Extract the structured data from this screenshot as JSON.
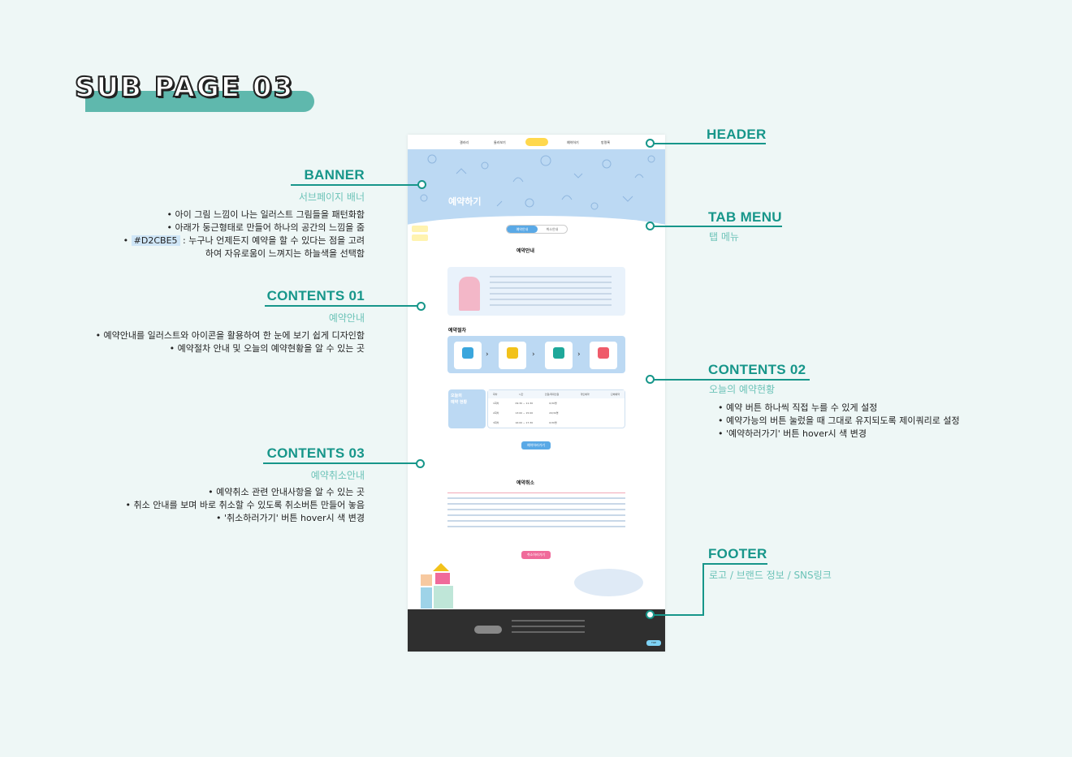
{
  "page_title": "SUB PAGE 03",
  "colors": {
    "accent": "#17968a",
    "banner_blue": "#D2CBE5",
    "footer": "#2f2f2f"
  },
  "annotations": {
    "header": {
      "title": "HEADER"
    },
    "banner": {
      "title": "BANNER",
      "subtitle": "서브페이지 배너",
      "lines": [
        "• 아이 그림 느낌이 나는  일러스트 그림들을 패턴화함",
        "• 아래가 둥근형태로 만들어 하나의 공간의 느낌을 줌",
        "#D2CBE5",
        ": 누구나 언제든지 예약을 할 수 있다는 점을 고려",
        "하여 자유로움이 느껴지는 하늘색을 선택함"
      ]
    },
    "tab_menu": {
      "title": "TAB MENU",
      "subtitle": "탭 메뉴"
    },
    "contents01": {
      "title": "CONTENTS 01",
      "subtitle": "예약안내",
      "lines": [
        "• 예약안내를 일러스트와 아이콘을 활용하여 한 눈에 보기 쉽게 디자인함",
        "• 예약절차 안내 및 오늘의 예약현황을 알 수 있는 곳"
      ]
    },
    "contents02": {
      "title": "CONTENTS 02",
      "subtitle": "오늘의 예약현황",
      "lines": [
        "• 예약 버튼 하나씩 직접 누를 수 있게 설정",
        "• 예약가능의 버튼 눌렀을 때 그대로 유지되도록 제이쿼리로 설정",
        "• '예약하러가기' 버튼 hover시 색 변경"
      ]
    },
    "contents03": {
      "title": "CONTENTS 03",
      "subtitle": "예약취소안내",
      "lines": [
        "• 예약취소 관련 안내사항을 알 수 있는 곳",
        "• 취소 안내를 보며 바로 취소할 수 있도록 취소버튼 만들어 놓음",
        "• '취소하러가기' 버튼 hover시 색 변경"
      ]
    },
    "footer": {
      "title": "FOOTER",
      "subtitle": "로고 / 브랜드 정보 / SNS링크"
    }
  },
  "mockup": {
    "nav": [
      "갤러리",
      "둘러보기",
      "예약하기",
      "방명록"
    ],
    "banner_title": "예약하기",
    "tabs": [
      "예약안내",
      "취소안내"
    ],
    "section_reserve": "예약안내",
    "section_steps": "예약절차",
    "today": [
      "오늘의",
      "예약 현황"
    ],
    "table_header": [
      "회차",
      "시간",
      "인원/최대인원",
      "개인예약",
      "단체예약"
    ],
    "table_rows": [
      [
        "1회차",
        "09:30 ~ 11:30",
        "0/30명"
      ],
      [
        "2회차",
        "13:00 ~ 15:00",
        "20/30명"
      ],
      [
        "3회차",
        "16:00 ~ 17:30",
        "0/30명"
      ]
    ],
    "btn_reserve": "예약하러가기",
    "section_cancel": "예약취소",
    "btn_cancel": "취소하러가기",
    "top_button": "TOP"
  }
}
